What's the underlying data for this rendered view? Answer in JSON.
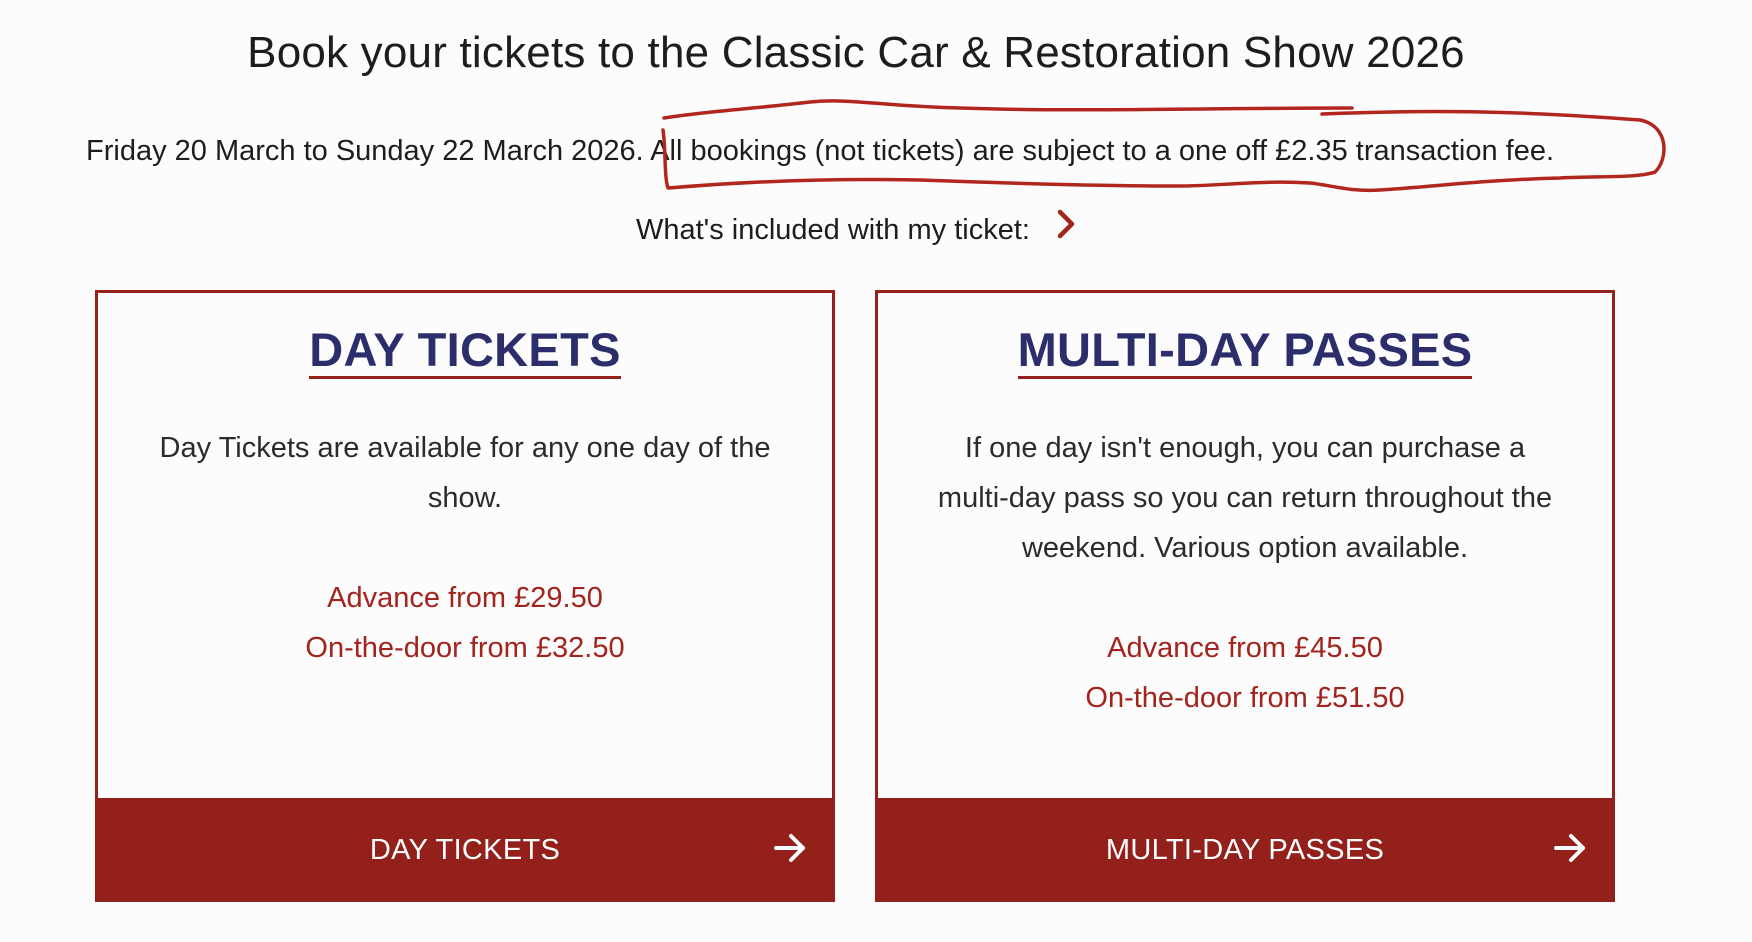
{
  "page": {
    "title": "Book your tickets to the Classic Car & Restoration Show 2026",
    "dates_text": "Friday 20 March to Sunday 22 March 2026.",
    "fee_text": "All bookings (not tickets) are subject to a one off £2.35 transaction fee.",
    "included_label": "What's included with my ticket:"
  },
  "cards": [
    {
      "heading": "DAY TICKETS",
      "description": "Day Tickets are available for any one day of the show.",
      "price_advance": "Advance from £29.50",
      "price_door": "On-the-door from £32.50",
      "button_label": "DAY TICKETS"
    },
    {
      "heading": "MULTI-DAY PASSES",
      "description": "If one day isn't enough, you can purchase a multi-day pass so you can return throughout the weekend. Various option available.",
      "price_advance": "Advance from £45.50",
      "price_door": "On-the-door from £51.50",
      "button_label": "MULTI-DAY PASSES"
    }
  ],
  "icons": {
    "included_toggle": "chevron-right-icon",
    "card_button": "arrow-right-icon"
  },
  "colors": {
    "accent_red": "#94201b",
    "heading_navy": "#2b2e6b",
    "price_red": "#a3231d",
    "annotation_red": "#b1271e"
  }
}
